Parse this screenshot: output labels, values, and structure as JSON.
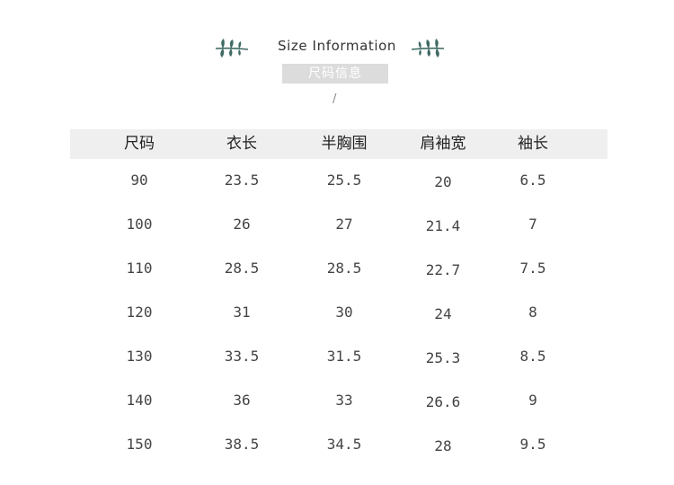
{
  "header": {
    "title": "Size Information",
    "subtitle": "尺码信息",
    "slash": "/"
  },
  "table": {
    "columns": [
      "尺码",
      "衣长",
      "半胸围",
      "肩袖宽",
      "袖长"
    ],
    "rows": [
      [
        "90",
        "23.5",
        "25.5",
        "20",
        "6.5"
      ],
      [
        "100",
        "26",
        "27",
        "21.4",
        "7"
      ],
      [
        "110",
        "28.5",
        "28.5",
        "22.7",
        "7.5"
      ],
      [
        "120",
        "31",
        "30",
        "24",
        "8"
      ],
      [
        "130",
        "33.5",
        "31.5",
        "25.3",
        "8.5"
      ],
      [
        "140",
        "36",
        "33",
        "26.6",
        "9"
      ],
      [
        "150",
        "38.5",
        "34.5",
        "28",
        "9.5"
      ]
    ]
  },
  "colors": {
    "leaf": "#3f6b64",
    "header_band": "#efefef",
    "subtitle_bg": "#dcdcdc"
  },
  "icons": [
    "leaf-branch-left-icon",
    "leaf-branch-right-icon"
  ]
}
